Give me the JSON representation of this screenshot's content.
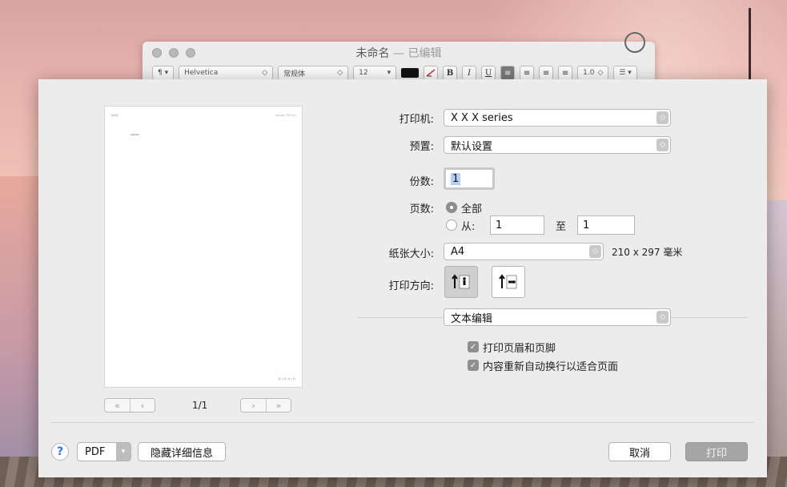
{
  "doc_window": {
    "title": "未命名",
    "title_sep": " — ",
    "edited": "已编辑",
    "toolbar": {
      "para": "¶ ▾",
      "font": "Helvetica",
      "style": "常规体",
      "size": "12",
      "bold": "B",
      "italic": "I",
      "underline": "U",
      "spacing": "1.0",
      "list": "☰ ▾"
    }
  },
  "preview": {
    "header_left": "未命名",
    "header_right": "15/2/20 下午3:02",
    "body_text": "xxxxxx",
    "footer": "第 1 页, 共 1 页",
    "page_count": "1/1"
  },
  "form": {
    "printer_label": "打印机:",
    "printer_value": "X X X series",
    "presets_label": "预置:",
    "presets_value": "默认设置",
    "copies_label": "份数:",
    "copies_value": "1",
    "pages_label": "页数:",
    "pages_all": "全部",
    "pages_from": "从:",
    "pages_from_value": "1",
    "pages_to": "至",
    "pages_to_value": "1",
    "paper_label": "纸张大小:",
    "paper_value": "A4",
    "paper_dims": "210 x 297 毫米",
    "orientation_label": "打印方向:",
    "app_section": "文本编辑",
    "print_header_footer": "打印页眉和页脚",
    "rewrap": "内容重新自动换行以适合页面"
  },
  "footer": {
    "help": "?",
    "pdf": "PDF",
    "hide_details": "隐藏详细信息",
    "cancel": "取消",
    "print": "打印"
  },
  "colors": {
    "sheet_bg": "#ececec",
    "selected_field": "#b6cff5",
    "disabled_button": "#a5a5a5"
  }
}
